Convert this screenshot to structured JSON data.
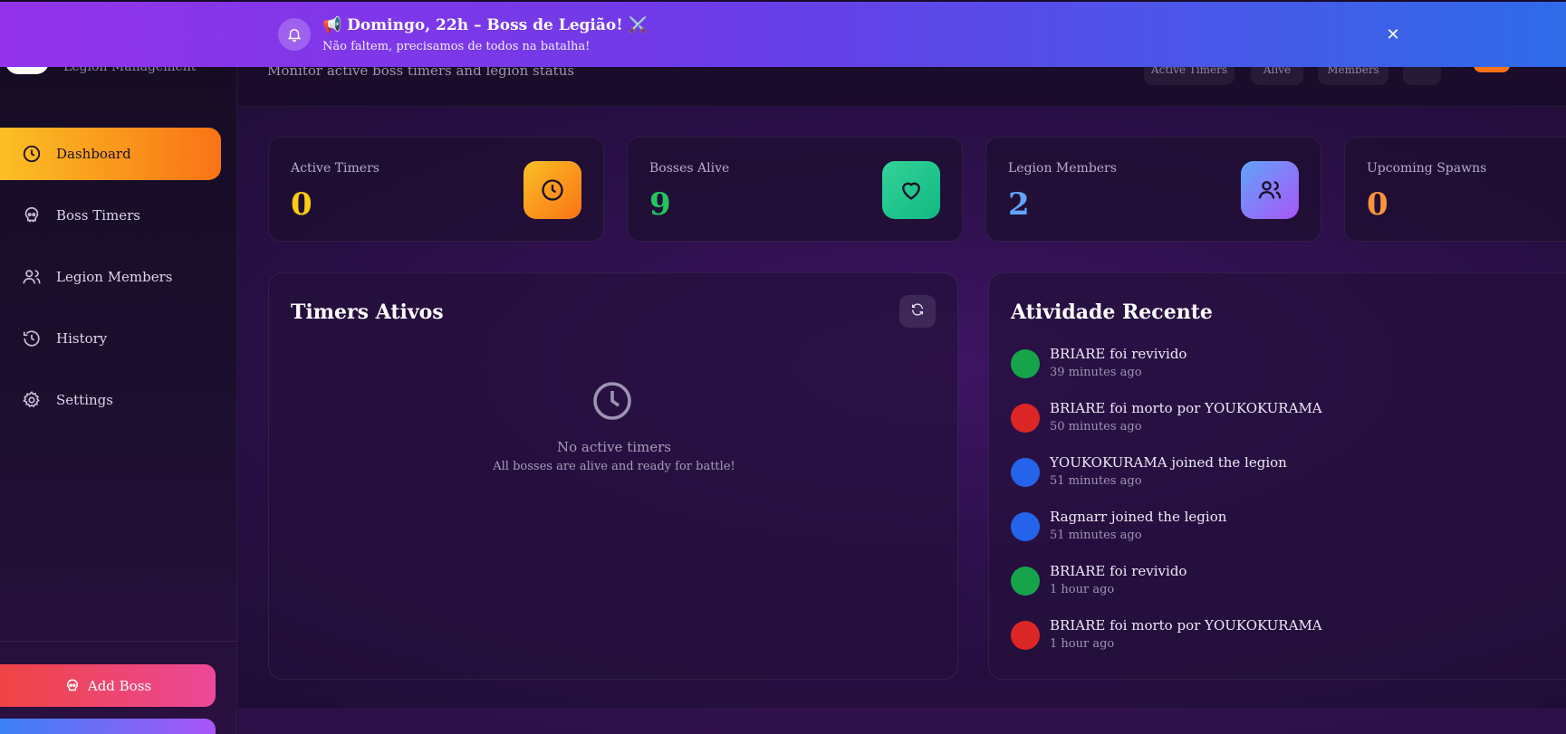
{
  "banner": {
    "icon": "bell-icon",
    "title": "📢 Domingo, 22h – Boss de Legião! ⚔️",
    "subtitle": "Não faltem, precisamos de todos na batalha!",
    "close_icon": "close-icon"
  },
  "brand": {
    "subtitle": "Legion Management"
  },
  "header": {
    "subtitle": "Monitor active boss timers and legion status",
    "pills": [
      "Active Timers",
      "Alive",
      "Members"
    ]
  },
  "sidebar": {
    "items": [
      {
        "label": "Dashboard",
        "icon": "clock-icon",
        "active": true
      },
      {
        "label": "Boss Timers",
        "icon": "skull-icon",
        "active": false
      },
      {
        "label": "Legion Members",
        "icon": "users-icon",
        "active": false
      },
      {
        "label": "History",
        "icon": "history-icon",
        "active": false
      },
      {
        "label": "Settings",
        "icon": "gear-icon",
        "active": false
      }
    ],
    "add_boss_label": "Add Boss"
  },
  "stats": [
    {
      "label": "Active Timers",
      "value": "0",
      "color": "#facc15",
      "icon": "clock-icon"
    },
    {
      "label": "Bosses Alive",
      "value": "9",
      "color": "#22c55e",
      "icon": "heart-icon"
    },
    {
      "label": "Legion Members",
      "value": "2",
      "color": "#60a5fa",
      "icon": "users-icon"
    },
    {
      "label": "Upcoming Spawns",
      "value": "0",
      "color": "#fb923c",
      "icon": "calendar-icon"
    }
  ],
  "timers_panel": {
    "title": "Timers Ativos",
    "empty_title": "No active timers",
    "empty_subtitle": "All bosses are alive and ready for battle!"
  },
  "activity_panel": {
    "title": "Atividade Recente",
    "items": [
      {
        "text": "BRIARE foi revivido",
        "time": "39 minutes ago",
        "color": "#16a34a"
      },
      {
        "text": "BRIARE foi morto por YOUKOKURAMA",
        "time": "50 minutes ago",
        "color": "#dc2626"
      },
      {
        "text": "YOUKOKURAMA joined the legion",
        "time": "51 minutes ago",
        "color": "#2563eb"
      },
      {
        "text": "Ragnarr joined the legion",
        "time": "51 minutes ago",
        "color": "#2563eb"
      },
      {
        "text": "BRIARE foi revivido",
        "time": "1 hour ago",
        "color": "#16a34a"
      },
      {
        "text": "BRIARE foi morto por YOUKOKURAMA",
        "time": "1 hour ago",
        "color": "#dc2626"
      }
    ]
  }
}
